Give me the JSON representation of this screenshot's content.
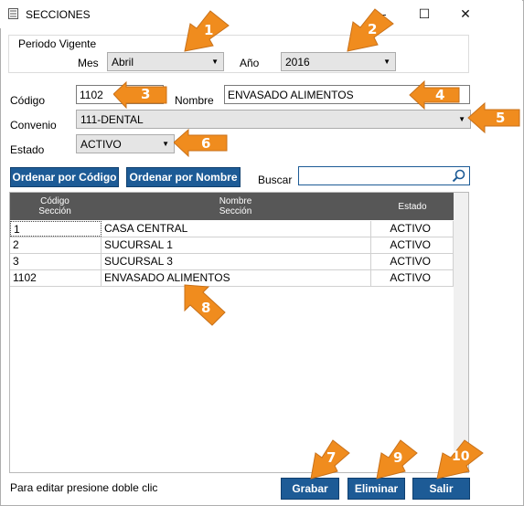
{
  "window": {
    "title": "SECCIONES",
    "controls": {
      "minimize": "—",
      "maximize": "☐",
      "close": "✕"
    }
  },
  "periodo": {
    "legend": "Periodo Vigente",
    "mes_label": "Mes",
    "mes_value": "Abril",
    "anio_label": "Año",
    "anio_value": "2016"
  },
  "form": {
    "codigo_label": "Código",
    "codigo_value": "1102",
    "nombre_label": "Nombre",
    "nombre_value": "ENVASADO ALIMENTOS",
    "convenio_label": "Convenio",
    "convenio_value": "111-DENTAL",
    "estado_label": "Estado",
    "estado_value": "ACTIVO"
  },
  "toolbar": {
    "order_code_label": "Ordenar por Código",
    "order_name_label": "Ordenar por Nombre",
    "buscar_label": "Buscar",
    "search_value": ""
  },
  "grid": {
    "headers": [
      "Código\nSección",
      "Nombre\nSección",
      "Estado"
    ],
    "rows": [
      [
        "1",
        "CASA CENTRAL",
        "ACTIVO"
      ],
      [
        "2",
        "SUCURSAL 1",
        "ACTIVO"
      ],
      [
        "3",
        "SUCURSAL 3",
        "ACTIVO"
      ],
      [
        "1102",
        "ENVASADO ALIMENTOS",
        "ACTIVO"
      ]
    ]
  },
  "footer": {
    "hint": "Para editar presione doble clic",
    "save_label": "Grabar",
    "delete_label": "Eliminar",
    "exit_label": "Salir"
  },
  "annotations": {
    "color": "#f08c1e",
    "numbers": [
      "1",
      "2",
      "3",
      "4",
      "5",
      "6",
      "7",
      "8",
      "9",
      "10"
    ]
  }
}
